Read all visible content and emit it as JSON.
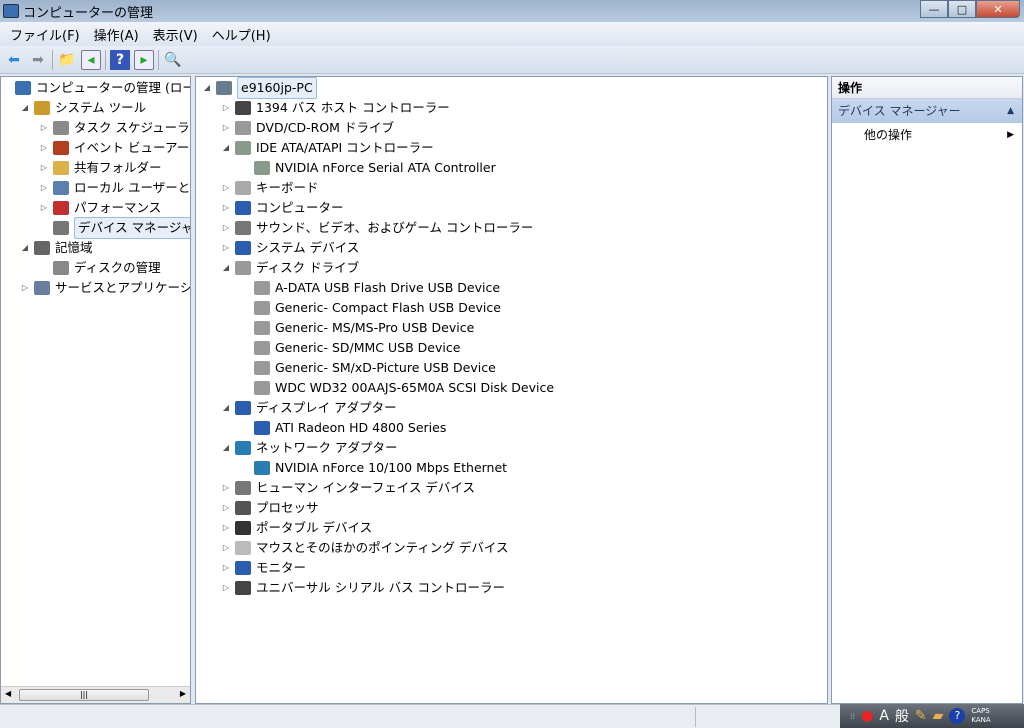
{
  "window": {
    "title": "コンピューターの管理",
    "minimize": "—",
    "maximize": "□",
    "close": "✕"
  },
  "menu": [
    "ファイル(F)",
    "操作(A)",
    "表示(V)",
    "ヘルプ(H)"
  ],
  "toolbar": [
    "back-icon",
    "forward-icon",
    "up-folder-icon",
    "show-hide-console-tree-icon",
    "help-icon",
    "show-hide-action-pane-icon",
    "scan-hardware-icon"
  ],
  "left_tree": [
    {
      "label": "コンピューターの管理 (ローカル)",
      "level": 0,
      "exp": "",
      "icon": "computer-management-icon",
      "color": "#3a6fb0"
    },
    {
      "label": "システム ツール",
      "level": 1,
      "exp": "◢",
      "icon": "tools-icon",
      "color": "#c99a2e"
    },
    {
      "label": "タスク スケジューラ",
      "level": 2,
      "exp": "▷",
      "icon": "clock-icon",
      "color": "#8a8a8a"
    },
    {
      "label": "イベント ビューアー",
      "level": 2,
      "exp": "▷",
      "icon": "event-viewer-icon",
      "color": "#b04020"
    },
    {
      "label": "共有フォルダー",
      "level": 2,
      "exp": "▷",
      "icon": "shared-folder-icon",
      "color": "#d9b24a"
    },
    {
      "label": "ローカル ユーザーとグループ",
      "level": 2,
      "exp": "▷",
      "icon": "users-icon",
      "color": "#5a7fb0"
    },
    {
      "label": "パフォーマンス",
      "level": 2,
      "exp": "▷",
      "icon": "performance-icon",
      "color": "#c03030"
    },
    {
      "label": "デバイス マネージャー",
      "level": 2,
      "exp": "",
      "icon": "device-manager-icon",
      "color": "#777",
      "selected": true
    },
    {
      "label": "記憶域",
      "level": 1,
      "exp": "◢",
      "icon": "storage-icon",
      "color": "#666"
    },
    {
      "label": "ディスクの管理",
      "level": 2,
      "exp": "",
      "icon": "disk-management-icon",
      "color": "#888"
    },
    {
      "label": "サービスとアプリケーション",
      "level": 1,
      "exp": "▷",
      "icon": "services-icon",
      "color": "#6a7fa0"
    }
  ],
  "device_tree": [
    {
      "label": "e9160jp-PC",
      "level": 0,
      "exp": "◢",
      "icon": "computer-icon",
      "color": "#6a7c90",
      "selected": true
    },
    {
      "label": "1394 バス ホスト コントローラー",
      "level": 1,
      "exp": "▷",
      "icon": "firewire-icon",
      "color": "#444"
    },
    {
      "label": "DVD/CD-ROM ドライブ",
      "level": 1,
      "exp": "▷",
      "icon": "dvd-icon",
      "color": "#999"
    },
    {
      "label": "IDE ATA/ATAPI コントローラー",
      "level": 1,
      "exp": "◢",
      "icon": "ide-icon",
      "color": "#8a9a8a"
    },
    {
      "label": "NVIDIA nForce Serial ATA Controller",
      "level": 2,
      "exp": "",
      "icon": "ide-icon",
      "color": "#8a9a8a"
    },
    {
      "label": "キーボード",
      "level": 1,
      "exp": "▷",
      "icon": "keyboard-icon",
      "color": "#aaa"
    },
    {
      "label": "コンピューター",
      "level": 1,
      "exp": "▷",
      "icon": "computer-icon",
      "color": "#2a5db0"
    },
    {
      "label": "サウンド、ビデオ、およびゲーム コントローラー",
      "level": 1,
      "exp": "▷",
      "icon": "speaker-icon",
      "color": "#777"
    },
    {
      "label": "システム デバイス",
      "level": 1,
      "exp": "▷",
      "icon": "system-device-icon",
      "color": "#2a5db0"
    },
    {
      "label": "ディスク ドライブ",
      "level": 1,
      "exp": "◢",
      "icon": "disk-drive-icon",
      "color": "#999"
    },
    {
      "label": "A-DATA USB Flash Drive USB Device",
      "level": 2,
      "exp": "",
      "icon": "disk-drive-icon",
      "color": "#999"
    },
    {
      "label": "Generic- Compact Flash USB Device",
      "level": 2,
      "exp": "",
      "icon": "disk-drive-icon",
      "color": "#999"
    },
    {
      "label": "Generic- MS/MS-Pro USB Device",
      "level": 2,
      "exp": "",
      "icon": "disk-drive-icon",
      "color": "#999"
    },
    {
      "label": "Generic- SD/MMC USB Device",
      "level": 2,
      "exp": "",
      "icon": "disk-drive-icon",
      "color": "#999"
    },
    {
      "label": "Generic- SM/xD-Picture USB Device",
      "level": 2,
      "exp": "",
      "icon": "disk-drive-icon",
      "color": "#999"
    },
    {
      "label": "WDC WD32 00AAJS-65M0A SCSI Disk Device",
      "level": 2,
      "exp": "",
      "icon": "disk-drive-icon",
      "color": "#999"
    },
    {
      "label": "ディスプレイ アダプター",
      "level": 1,
      "exp": "◢",
      "icon": "display-adapter-icon",
      "color": "#2a5db0"
    },
    {
      "label": "ATI Radeon HD 4800 Series",
      "level": 2,
      "exp": "",
      "icon": "display-adapter-icon",
      "color": "#2a5db0"
    },
    {
      "label": "ネットワーク アダプター",
      "level": 1,
      "exp": "◢",
      "icon": "network-adapter-icon",
      "color": "#2a7db0"
    },
    {
      "label": "NVIDIA nForce 10/100 Mbps Ethernet",
      "level": 2,
      "exp": "",
      "icon": "network-adapter-icon",
      "color": "#2a7db0"
    },
    {
      "label": "ヒューマン インターフェイス デバイス",
      "level": 1,
      "exp": "▷",
      "icon": "hid-icon",
      "color": "#777"
    },
    {
      "label": "プロセッサ",
      "level": 1,
      "exp": "▷",
      "icon": "processor-icon",
      "color": "#555"
    },
    {
      "label": "ポータブル デバイス",
      "level": 1,
      "exp": "▷",
      "icon": "portable-device-icon",
      "color": "#333"
    },
    {
      "label": "マウスとそのほかのポインティング デバイス",
      "level": 1,
      "exp": "▷",
      "icon": "mouse-icon",
      "color": "#bbb"
    },
    {
      "label": "モニター",
      "level": 1,
      "exp": "▷",
      "icon": "monitor-icon",
      "color": "#2a5db0"
    },
    {
      "label": "ユニバーサル シリアル バス コントローラー",
      "level": 1,
      "exp": "▷",
      "icon": "usb-icon",
      "color": "#444"
    }
  ],
  "actions": {
    "header": "操作",
    "section": "デバイス マネージャー",
    "section_arrow": "▲",
    "item": "他の操作",
    "item_arrow": "▶"
  },
  "tray": {
    "ime_mode": "A",
    "ime_conv": "般",
    "caps": "CAPS",
    "kana": "KANA",
    "help": "?"
  }
}
